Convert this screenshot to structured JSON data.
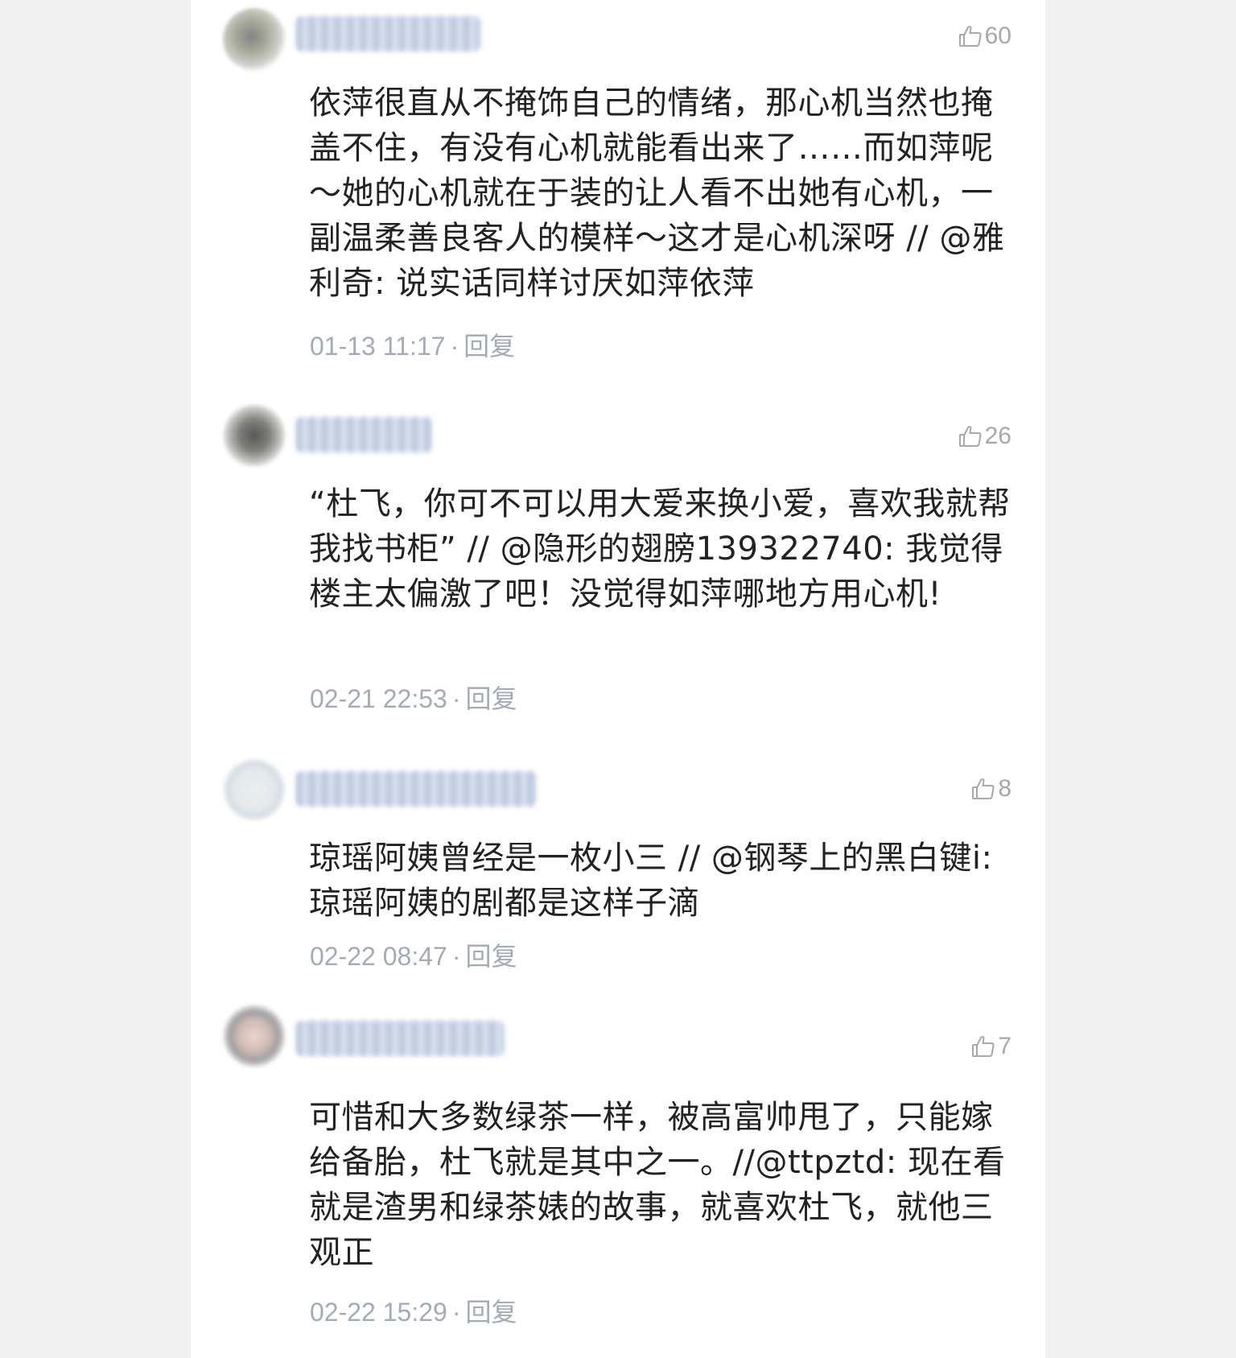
{
  "comments": [
    {
      "likes": "60",
      "text": "依萍很直从不掩饰自己的情绪，那心机当然也掩盖不住，有没有心机就能看出来了……而如萍呢～她的心机就在于装的让人看不出她有心机，一副温柔善良客人的模样～这才是心机深呀 // @雅利奇: 说实话同样讨厌如萍依萍",
      "time": "01-13 11:17",
      "reply_label": "回复"
    },
    {
      "likes": "26",
      "text": "“杜飞，你可不可以用大爱来换小爱，喜欢我就帮我找书柜” // @隐形的翅膀139322740: 我觉得楼主太偏激了吧！没觉得如萍哪地方用心机!",
      "time": "02-21 22:53",
      "reply_label": "回复"
    },
    {
      "likes": "8",
      "text": "琼瑶阿姨曾经是一枚小三 // @钢琴上的黑白键i: 琼瑶阿姨的剧都是这样子滴",
      "time": "02-22 08:47",
      "reply_label": "回复"
    },
    {
      "likes": "7",
      "text": "可惜和大多数绿茶一样，被高富帅甩了，只能嫁给备胎，杜飞就是其中之一。//@ttpztd: 现在看就是渣男和绿茶婊的故事，就喜欢杜飞，就他三观正",
      "time": "02-22 15:29",
      "reply_label": "回复"
    }
  ],
  "icons": {
    "like": "thumbs-up-icon"
  },
  "colors": {
    "text": "#222222",
    "meta": "#a3abb8",
    "like": "#a8a8a8",
    "panel": "#ffffff",
    "background": "#f1f1f1"
  }
}
